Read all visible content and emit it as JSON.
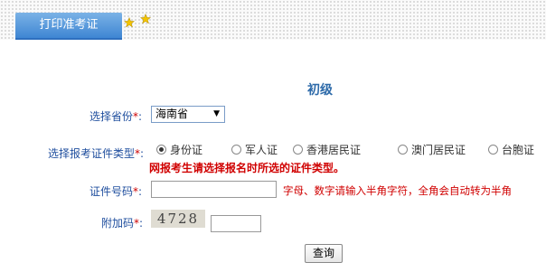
{
  "header": {
    "tab_label": "打印准考证",
    "star_color": "#f3c400",
    "tab_color": "#4a8fd8"
  },
  "level_title": "初级",
  "form": {
    "required_mark": "*",
    "colon": ":",
    "province_label": "选择省份",
    "province_value": "海南省",
    "cert_type_label": "选择报考证件类型",
    "cert_options": [
      {
        "label": "身份证",
        "selected": true
      },
      {
        "label": "军人证",
        "selected": false
      },
      {
        "label": "香港居民证",
        "selected": false
      },
      {
        "label": "澳门居民证",
        "selected": false
      },
      {
        "label": "台胞证",
        "selected": false
      }
    ],
    "cert_warning": "网报考生请选择报名时所选的证件类型。",
    "id_number_label": "证件号码",
    "id_number_value": "",
    "id_number_hint": "字母、数字请输入半角字符，全角会自动转为半角",
    "captcha_label": "附加码",
    "captcha_image_text": "4728",
    "captcha_value": "",
    "submit_label": "查询"
  }
}
